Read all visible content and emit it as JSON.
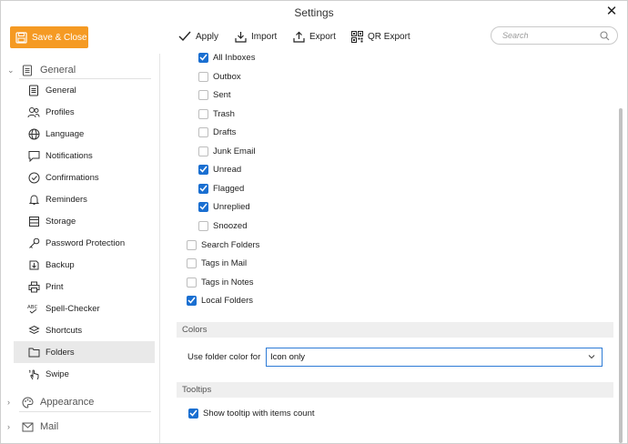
{
  "window": {
    "title": "Settings"
  },
  "toolbar": {
    "save_close": "Save & Close",
    "apply": "Apply",
    "import": "Import",
    "export": "Export",
    "qr_export": "QR Export",
    "search_placeholder": "Search"
  },
  "sidebar": {
    "general": {
      "label": "General",
      "items": [
        {
          "label": "General",
          "icon": "document-icon"
        },
        {
          "label": "Profiles",
          "icon": "users-icon"
        },
        {
          "label": "Language",
          "icon": "globe-icon"
        },
        {
          "label": "Notifications",
          "icon": "speech-bubble-icon"
        },
        {
          "label": "Confirmations",
          "icon": "check-circle-icon"
        },
        {
          "label": "Reminders",
          "icon": "bell-icon"
        },
        {
          "label": "Storage",
          "icon": "database-icon"
        },
        {
          "label": "Password Protection",
          "icon": "key-icon"
        },
        {
          "label": "Backup",
          "icon": "backup-icon"
        },
        {
          "label": "Print",
          "icon": "printer-icon"
        },
        {
          "label": "Spell-Checker",
          "icon": "spellcheck-icon"
        },
        {
          "label": "Shortcuts",
          "icon": "shortcuts-icon"
        },
        {
          "label": "Folders",
          "icon": "folder-icon",
          "selected": true
        },
        {
          "label": "Swipe",
          "icon": "swipe-hand-icon"
        }
      ]
    },
    "appearance": {
      "label": "Appearance"
    },
    "mail": {
      "label": "Mail"
    }
  },
  "folders": {
    "sub_items": [
      {
        "label": "All Inboxes",
        "checked": true
      },
      {
        "label": "Outbox",
        "checked": false
      },
      {
        "label": "Sent",
        "checked": false
      },
      {
        "label": "Trash",
        "checked": false
      },
      {
        "label": "Drafts",
        "checked": false
      },
      {
        "label": "Junk Email",
        "checked": false
      },
      {
        "label": "Unread",
        "checked": true
      },
      {
        "label": "Flagged",
        "checked": true
      },
      {
        "label": "Unreplied",
        "checked": true
      },
      {
        "label": "Snoozed",
        "checked": false
      }
    ],
    "top_items": [
      {
        "label": "Search Folders",
        "checked": false
      },
      {
        "label": "Tags in Mail",
        "checked": false
      },
      {
        "label": "Tags in Notes",
        "checked": false
      },
      {
        "label": "Local Folders",
        "checked": true
      }
    ]
  },
  "colors": {
    "section_title": "Colors",
    "use_folder_color_label": "Use folder color for",
    "use_folder_color_value": "Icon only"
  },
  "tooltips": {
    "section_title": "Tooltips",
    "show_count_label": "Show tooltip with items count",
    "show_count_checked": true
  },
  "theme": {
    "accent": "#f59a23",
    "checkbox": "#1a6fd1",
    "selection_bg": "#e9e9e9"
  }
}
